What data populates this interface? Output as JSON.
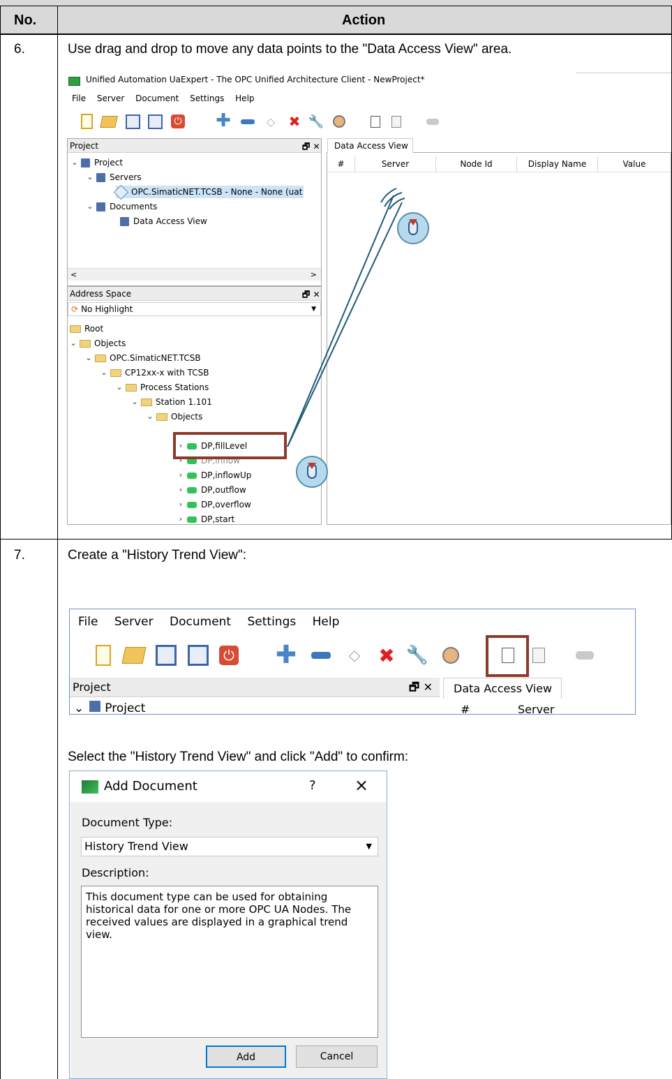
{
  "table": {
    "col_no": "No.",
    "col_action": "Action"
  },
  "step6": {
    "no": "6.",
    "text": "Use drag and drop to move any data points to the \"Data Access View\" area.",
    "window_title": "Unified Automation UaExpert - The OPC Unified Architecture Client - NewProject*",
    "menu": [
      "File",
      "Server",
      "Document",
      "Settings",
      "Help"
    ],
    "project_panel": {
      "title": "Project",
      "items": [
        "Project",
        "Servers",
        "OPC.SimaticNET.TCSB - None - None (uat",
        "Documents",
        "Data Access View"
      ]
    },
    "address_panel": {
      "title": "Address Space",
      "highlight": "No Highlight",
      "items": [
        "Root",
        "Objects",
        "OPC.SimaticNET.TCSB",
        "CP12xx-x with TCSB",
        "Process Stations",
        "Station 1.101",
        "Objects",
        "DP,fillLevel",
        "DP,inflow",
        "DP,inflowUp",
        "DP,outflow",
        "DP,overflow",
        "DP,start"
      ]
    },
    "dav": {
      "tab": "Data Access View",
      "columns": [
        "#",
        "Server",
        "Node Id",
        "Display Name",
        "Value"
      ]
    }
  },
  "step7": {
    "no": "7.",
    "text1": "Create a \"History Trend View\":",
    "menu": [
      "File",
      "Server",
      "Document",
      "Settings",
      "Help"
    ],
    "project_title": "Project",
    "project_item": "Project",
    "dav_tab": "Data Access View",
    "col_hash": "#",
    "col_server": "Server",
    "text2": "Select the \"History Trend View\" and click \"Add\" to confirm:",
    "dialog": {
      "title": "Add Document",
      "help": "?",
      "close": "×",
      "doc_type_label": "Document Type:",
      "doc_type_value": "History Trend View",
      "desc_label": "Description:",
      "description": "This document type can be used for obtaining historical data for one or more OPC UA Nodes. The received values are displayed in a graphical trend view.",
      "add": "Add",
      "cancel": "Cancel"
    }
  },
  "colors": {
    "highlight_box": "#8b3a2b",
    "drag_line": "#1f5a7a"
  }
}
